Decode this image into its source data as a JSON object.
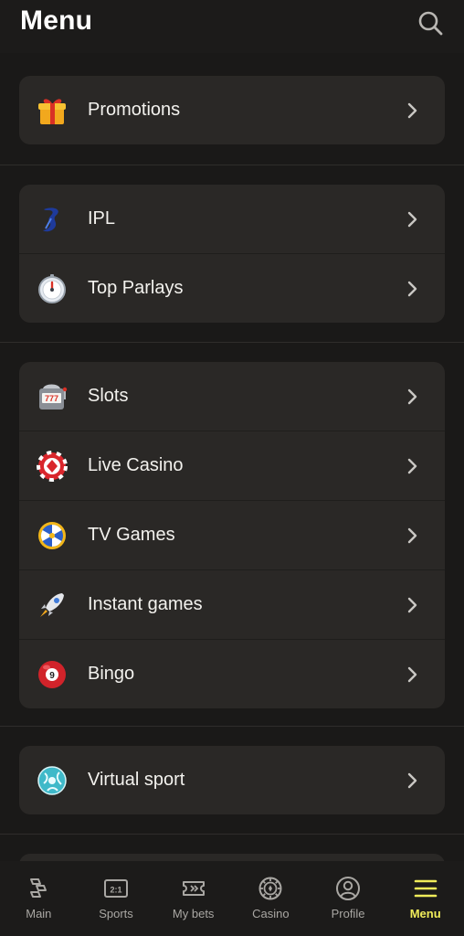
{
  "header": {
    "title": "Menu",
    "search_icon": "search-icon"
  },
  "groups": [
    {
      "items": [
        {
          "label": "Promotions",
          "icon": "gift-icon"
        }
      ]
    },
    {
      "items": [
        {
          "label": "IPL",
          "icon": "ipl-logo-icon"
        },
        {
          "label": "Top Parlays",
          "icon": "stopwatch-icon"
        }
      ]
    },
    {
      "items": [
        {
          "label": "Slots",
          "icon": "slot-machine-icon"
        },
        {
          "label": "Live Casino",
          "icon": "poker-chip-icon"
        },
        {
          "label": "TV Games",
          "icon": "wheel-of-fortune-icon"
        },
        {
          "label": "Instant games",
          "icon": "rocket-icon"
        },
        {
          "label": "Bingo",
          "icon": "billiard-ball-icon"
        }
      ]
    },
    {
      "items": [
        {
          "label": "Virtual sport",
          "icon": "globe-ball-icon"
        }
      ]
    }
  ],
  "bottom_nav": {
    "items": [
      {
        "label": "Main",
        "icon": "main-icon"
      },
      {
        "label": "Sports",
        "icon": "scoreboard-icon"
      },
      {
        "label": "My bets",
        "icon": "ticket-icon"
      },
      {
        "label": "Casino",
        "icon": "casino-chip-icon"
      },
      {
        "label": "Profile",
        "icon": "profile-icon"
      },
      {
        "label": "Menu",
        "icon": "hamburger-menu-icon"
      }
    ],
    "active": "Menu"
  },
  "colors": {
    "background": "#1a1918",
    "card": "#2a2826",
    "accent": "#f0ec5a",
    "text": "#f3f2ee",
    "muted": "#a9a7a3"
  }
}
